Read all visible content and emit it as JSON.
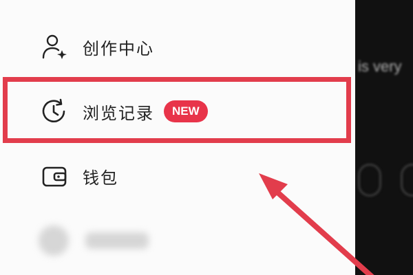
{
  "menu": {
    "items": [
      {
        "label": "创作中心",
        "icon": "user-plus-icon"
      },
      {
        "label": "浏览记录",
        "icon": "history-clock-icon",
        "badge": "NEW"
      },
      {
        "label": "钱包",
        "icon": "wallet-icon"
      }
    ]
  },
  "backdrop": {
    "text": "is very"
  },
  "colors": {
    "highlight": "#e23d4c",
    "badge": "#e8344a",
    "arrow": "#e23d4c",
    "drawer_bg": "#fbfbfb",
    "backdrop_bg": "#111111"
  }
}
